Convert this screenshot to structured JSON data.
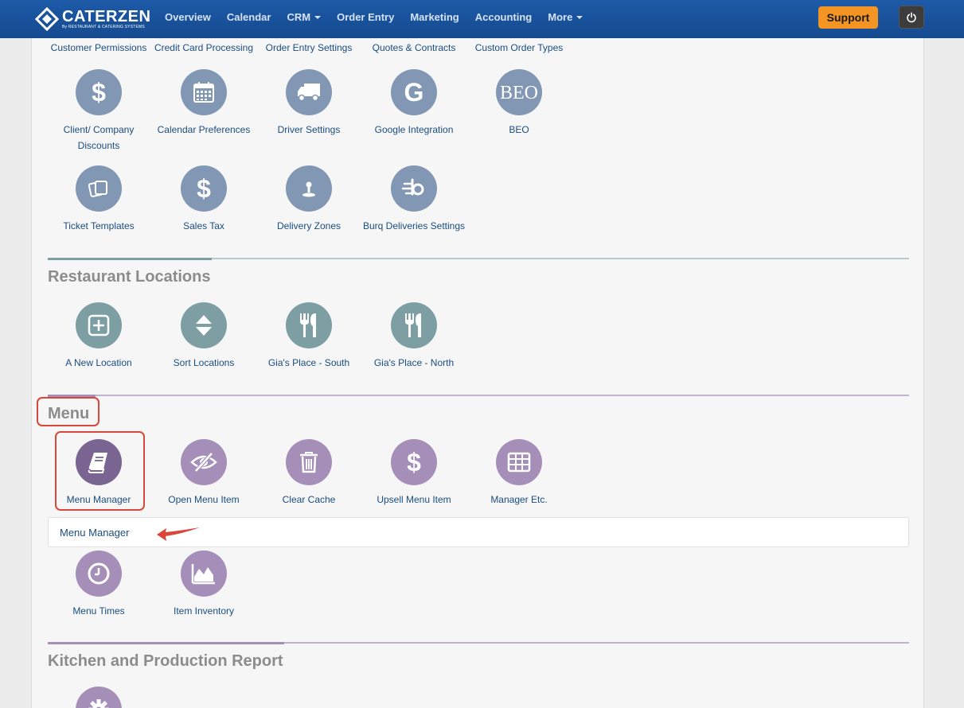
{
  "navbar": {
    "logo_name": "CATERZEN",
    "logo_sub": "By RESTAURANT & CATERING SYSTEMS",
    "links": [
      "Overview",
      "Calendar",
      "CRM",
      "Order Entry",
      "Marketing",
      "Accounting",
      "More"
    ],
    "support_label": "Support"
  },
  "top_labels": [
    "Customer Permissions",
    "Credit Card Processing",
    "Order Entry Settings",
    "Quotes & Contracts",
    "Custom Order Types"
  ],
  "settings_tiles": [
    {
      "label": "Client/ Company Discounts",
      "icon": "dollar-icon"
    },
    {
      "label": "Calendar Preferences",
      "icon": "calendar-icon"
    },
    {
      "label": "Driver Settings",
      "icon": "truck-icon"
    },
    {
      "label": "Google Integration",
      "icon": "google-icon"
    },
    {
      "label": "BEO",
      "icon": "beo-icon",
      "icon_text": "BEO"
    },
    {
      "label": "Ticket Templates",
      "icon": "copy-icon"
    },
    {
      "label": "Sales Tax",
      "icon": "dollar-icon"
    },
    {
      "label": "Delivery Zones",
      "icon": "map-pin-icon"
    },
    {
      "label": "Burq Deliveries Settings",
      "icon": "burq-icon"
    }
  ],
  "restaurant_locations": {
    "title": "Restaurant Locations",
    "tiles": [
      {
        "label": "A New Location",
        "icon": "plus-square-icon"
      },
      {
        "label": "Sort Locations",
        "icon": "sort-icon"
      },
      {
        "label": "Gia's Place - South",
        "icon": "utensils-icon"
      },
      {
        "label": "Gia's Place - North",
        "icon": "utensils-icon"
      }
    ]
  },
  "menu": {
    "title": "Menu",
    "tiles": [
      {
        "label": "Menu Manager",
        "icon": "book-icon"
      },
      {
        "label": "Open Menu Item",
        "icon": "eye-slash-icon"
      },
      {
        "label": "Clear Cache",
        "icon": "trash-icon"
      },
      {
        "label": "Upsell Menu Item",
        "icon": "dollar-icon"
      },
      {
        "label": "Manager Etc.",
        "icon": "table-icon"
      },
      {
        "label": "Menu Times",
        "icon": "clock-icon"
      },
      {
        "label": "Item Inventory",
        "icon": "area-chart-icon"
      }
    ],
    "tooltip": "Menu Manager"
  },
  "kitchen": {
    "title": "Kitchen and Production Report",
    "tiles": [
      {
        "label": "",
        "icon": "gear-icon"
      }
    ]
  },
  "colors": {
    "navbar": "#1d5aa8",
    "support": "#f39423",
    "settings_icon": "#8297b4",
    "locations_icon": "#7d9fa4",
    "menu_icon": "#a58fb8",
    "menu_icon_active": "#7a6491",
    "highlight": "#d9473a",
    "link_text": "#1a4d80"
  }
}
